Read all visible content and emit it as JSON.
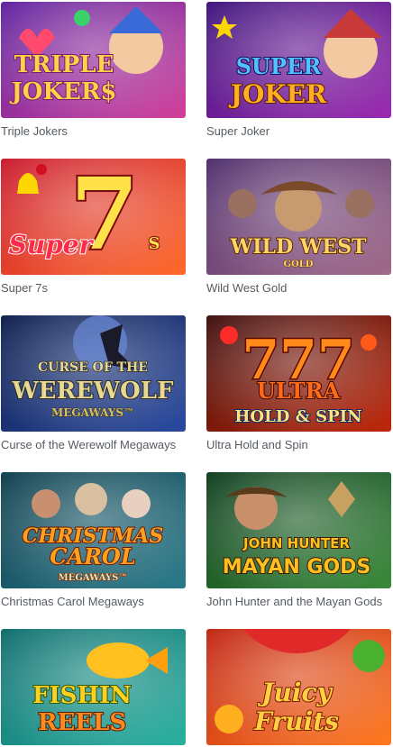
{
  "games": [
    {
      "title": "Triple Jokers",
      "logo": [
        "TRIPLE",
        "JOKER$"
      ],
      "palette": {
        "bg1": "#5a1f9e",
        "bg2": "#d2409a",
        "text": "#ffd24a",
        "stroke": "#7a1b6a",
        "accent": "#ff4a6e"
      }
    },
    {
      "title": "Super Joker",
      "logo": [
        "SUPER",
        "JOKER"
      ],
      "palette": {
        "bg1": "#3a0f7a",
        "bg2": "#9b2bb0",
        "text": "#ffb020",
        "stroke": "#5a1a00",
        "accent": "#4fc3ff"
      }
    },
    {
      "title": "Super 7s",
      "logo": [
        "7",
        "Super",
        "S"
      ],
      "palette": {
        "bg1": "#c9152a",
        "bg2": "#ff6a2a",
        "text": "#ffe14a",
        "stroke": "#7a0a0a",
        "accent": "#ffd700"
      }
    },
    {
      "title": "Wild West Gold",
      "logo": [
        "WILD WEST",
        "GOLD"
      ],
      "palette": {
        "bg1": "#4a2a6a",
        "bg2": "#a26a8a",
        "text": "#ffd56a",
        "stroke": "#5a2a00",
        "accent": "#7a4a2a"
      }
    },
    {
      "title": "Curse of the Werewolf Megaways",
      "logo": [
        "CURSE OF THE",
        "WEREWOLF",
        "MEGAWAYS™"
      ],
      "palette": {
        "bg1": "#0a1a4a",
        "bg2": "#2a4aa0",
        "text": "#e8d890",
        "stroke": "#2a2a2a",
        "accent": "#8ab0ff"
      }
    },
    {
      "title": "Ultra Hold and Spin",
      "logo": [
        "777",
        "ULTRA",
        "HOLD & SPIN"
      ],
      "palette": {
        "bg1": "#3a0a0a",
        "bg2": "#c0280a",
        "text": "#ffb030",
        "stroke": "#3a0a00",
        "accent": "#ffe27a"
      }
    },
    {
      "title": "Christmas Carol Megaways",
      "logo": [
        "CHRISTMAS",
        "CAROL",
        "MEGAWAYS™"
      ],
      "palette": {
        "bg1": "#0a3a4a",
        "bg2": "#2a7a8a",
        "text": "#ffa020",
        "stroke": "#6a1a00",
        "accent": "#ffe0a0"
      }
    },
    {
      "title": "John Hunter and the Mayan Gods",
      "logo": [
        "JOHN HUNTER",
        "MAYAN GODS"
      ],
      "palette": {
        "bg1": "#0a3a1a",
        "bg2": "#3a8a3a",
        "text": "#ffc020",
        "stroke": "#3a1a00",
        "accent": "#c8a060"
      }
    },
    {
      "title": "Fishin Reels",
      "logo": [
        "FISHIN",
        "REELS"
      ],
      "palette": {
        "bg1": "#0a6a6a",
        "bg2": "#2ab0a0",
        "text": "#ffd020",
        "stroke": "#7a3a00",
        "accent": "#ff8a20"
      }
    },
    {
      "title": "Juicy Fruits",
      "logo": [
        "Juicy",
        "Fruits"
      ],
      "palette": {
        "bg1": "#c02010",
        "bg2": "#ff7a20",
        "text": "#ffd040",
        "stroke": "#7a1a00",
        "accent": "#4ab030"
      }
    }
  ]
}
